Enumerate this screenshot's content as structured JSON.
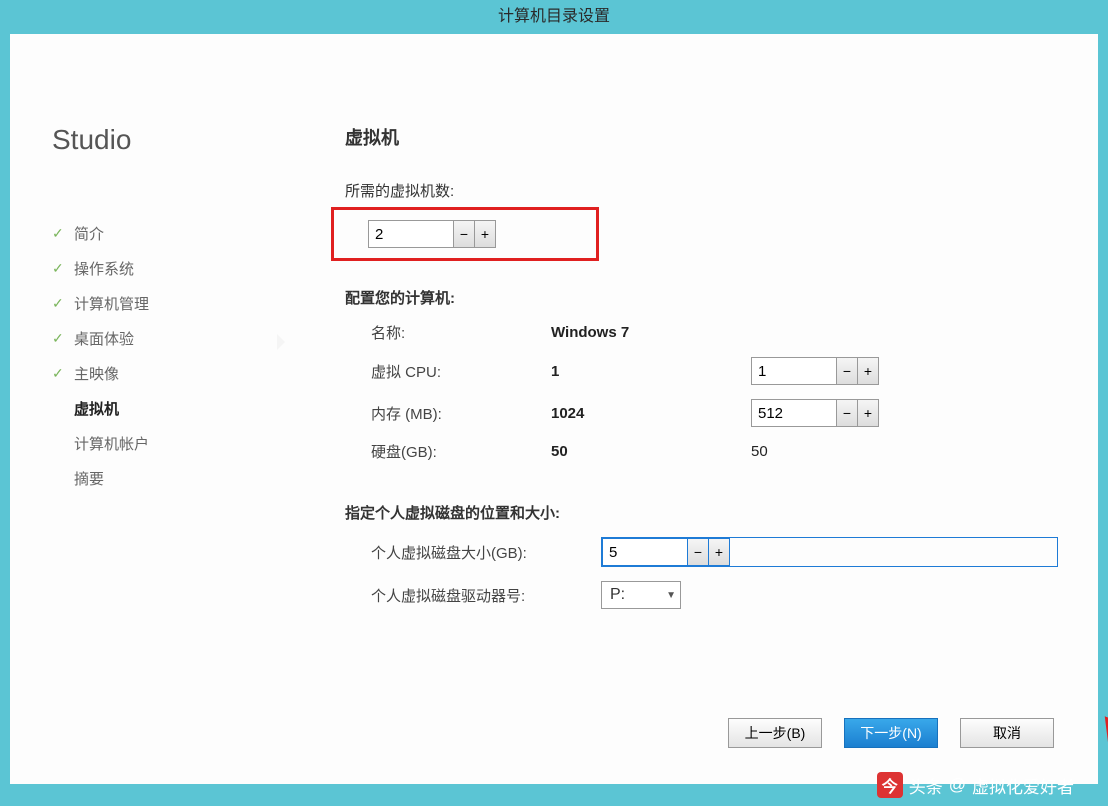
{
  "titlebar": "计算机目录设置",
  "sidebar": {
    "title": "Studio",
    "items": [
      {
        "label": "简介",
        "done": true,
        "active": false
      },
      {
        "label": "操作系统",
        "done": true,
        "active": false
      },
      {
        "label": "计算机管理",
        "done": true,
        "active": false
      },
      {
        "label": "桌面体验",
        "done": true,
        "active": false
      },
      {
        "label": "主映像",
        "done": true,
        "active": false
      },
      {
        "label": "虚拟机",
        "done": false,
        "active": true
      },
      {
        "label": "计算机帐户",
        "done": false,
        "active": false
      },
      {
        "label": "摘要",
        "done": false,
        "active": false
      }
    ]
  },
  "main": {
    "heading": "虚拟机",
    "vm_count_label": "所需的虚拟机数:",
    "vm_count_value": "2",
    "config_title": "配置您的计算机:",
    "rows": {
      "name": {
        "label": "名称:",
        "value": "Windows 7"
      },
      "cpu": {
        "label": "虚拟 CPU:",
        "value": "1",
        "input": "1"
      },
      "mem": {
        "label": "内存 (MB):",
        "value": "1024",
        "input": "512"
      },
      "disk": {
        "label": "硬盘(GB):",
        "value": "50",
        "value2": "50"
      }
    },
    "personal_disk_title": "指定个人虚拟磁盘的位置和大小:",
    "personal_disk_size_label": "个人虚拟磁盘大小(GB):",
    "personal_disk_size_value": "5",
    "personal_disk_drive_label": "个人虚拟磁盘驱动器号:",
    "personal_disk_drive_value": "P:"
  },
  "buttons": {
    "back": "上一步(B)",
    "next": "下一步(N)",
    "cancel": "取消"
  },
  "watermark": {
    "source": "头条",
    "at": "@",
    "author": "虚拟化爱好者"
  }
}
